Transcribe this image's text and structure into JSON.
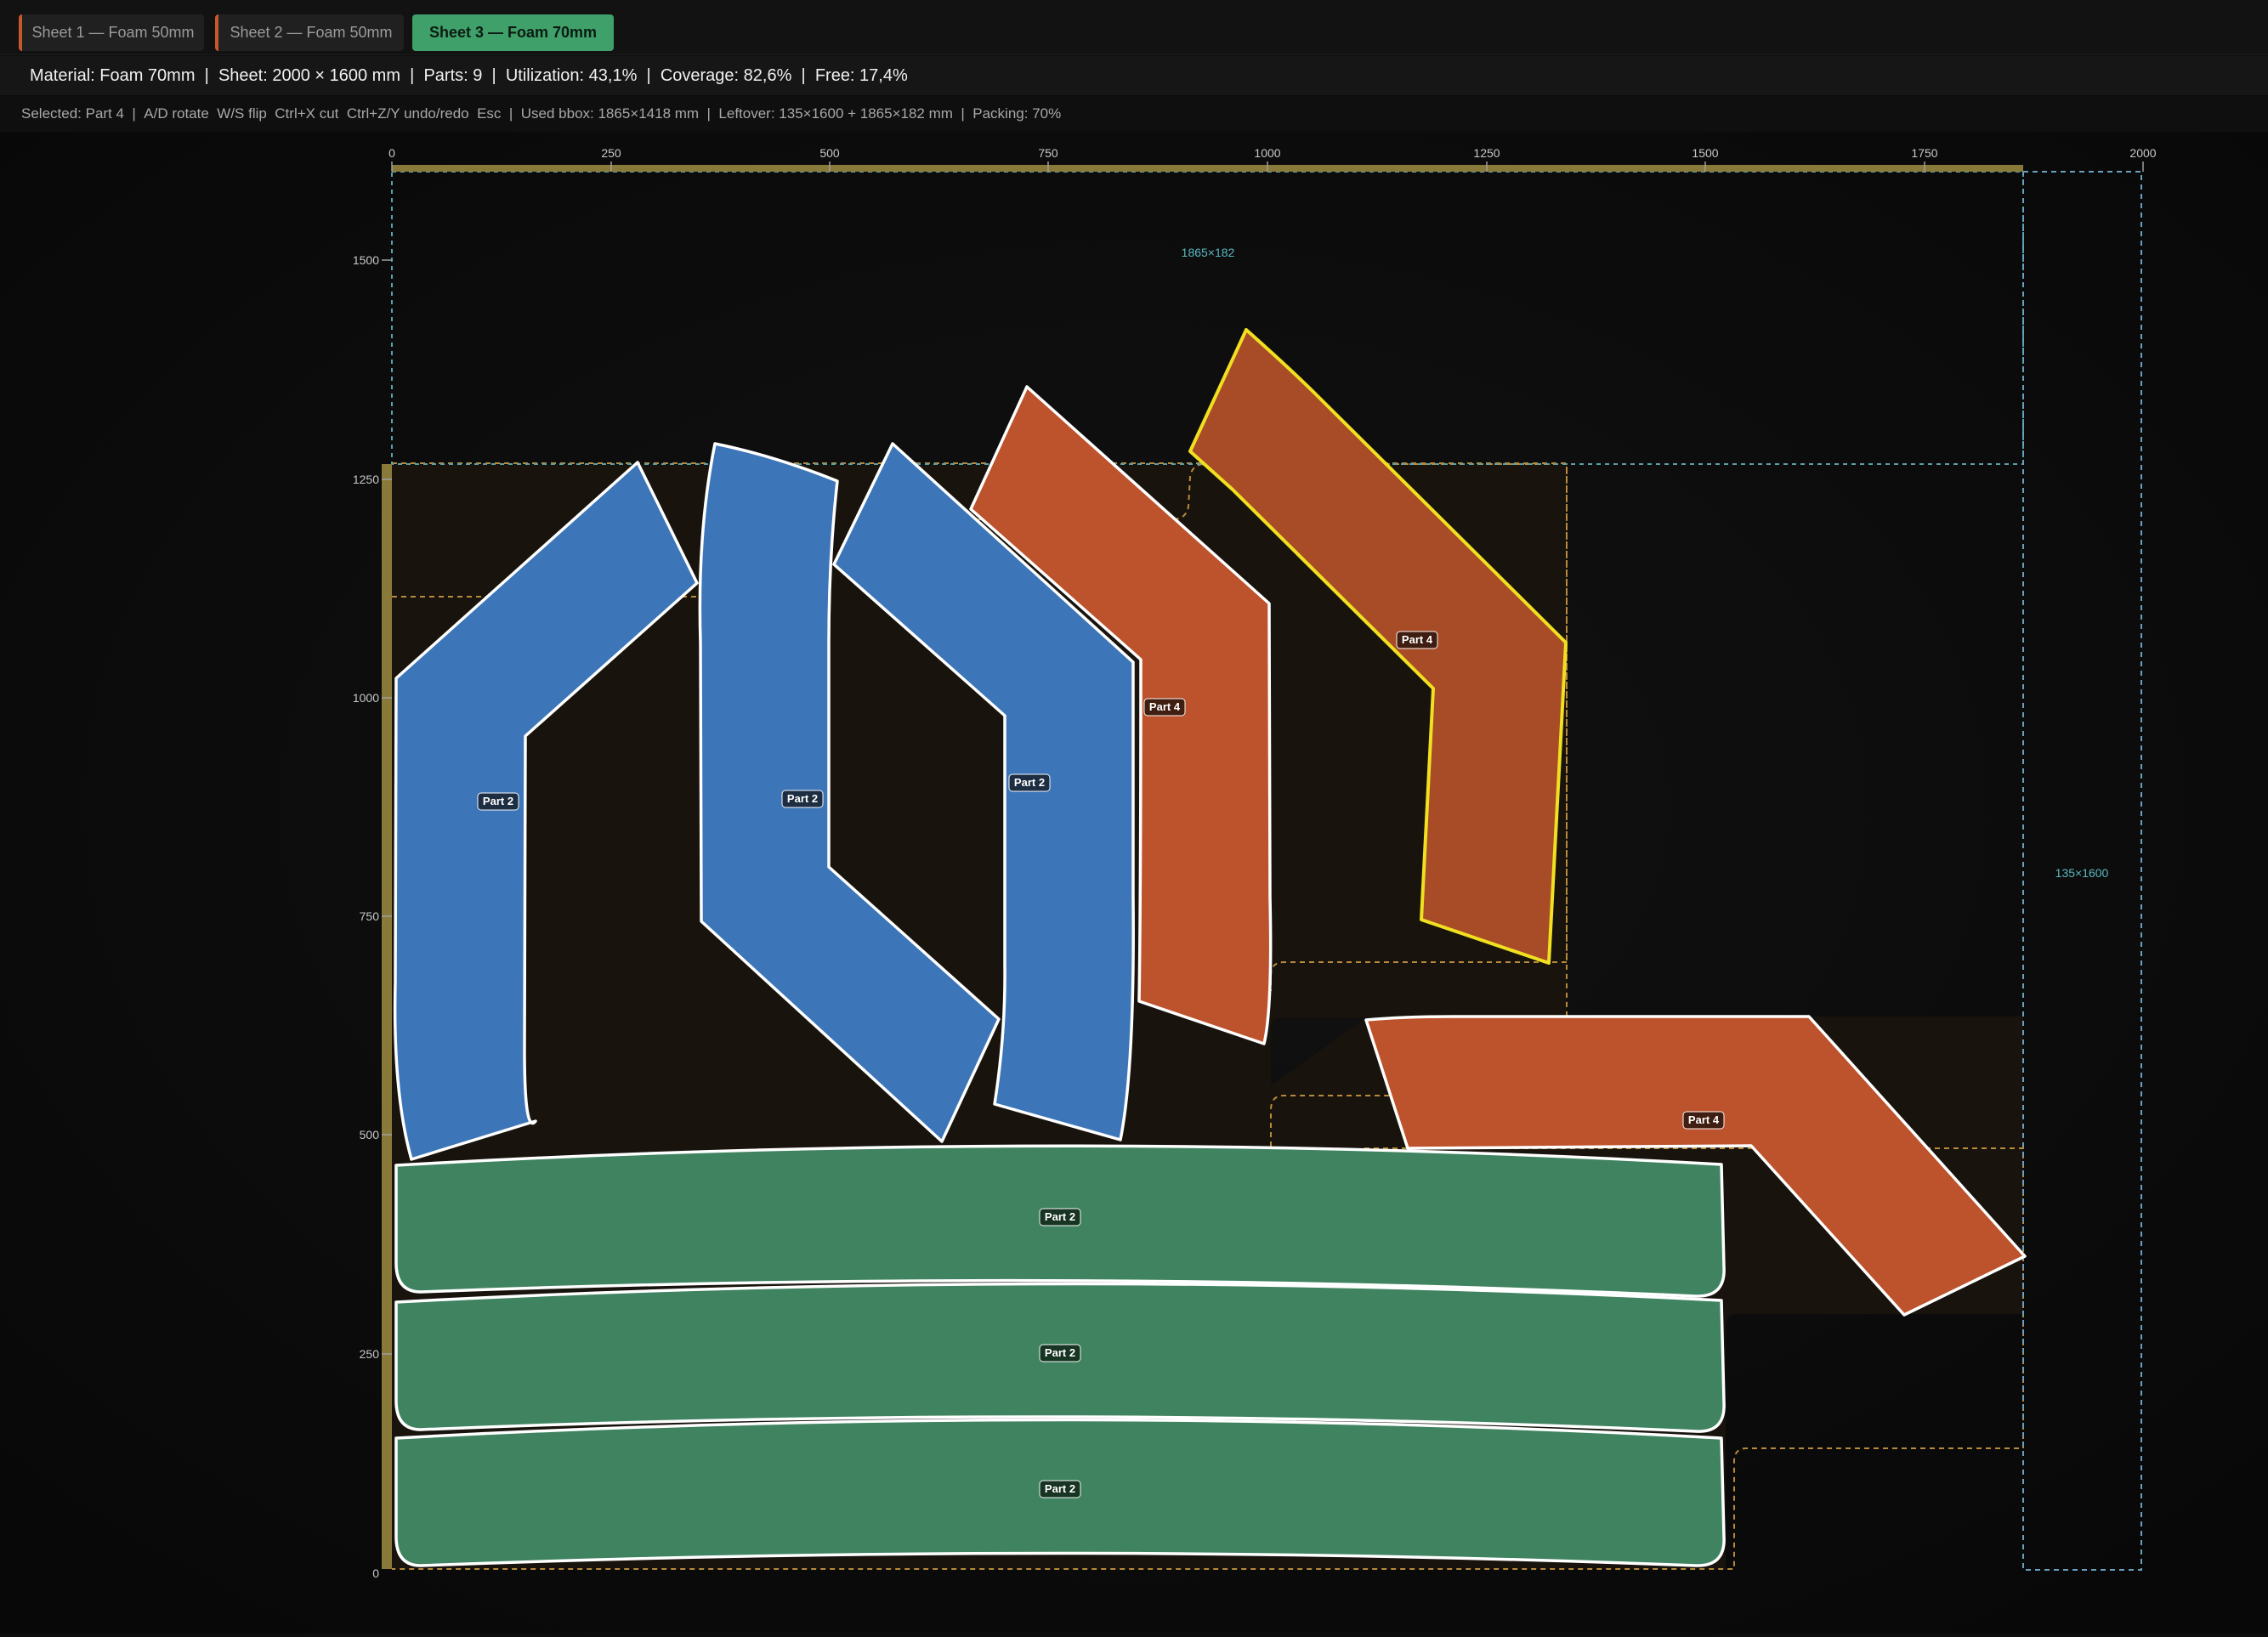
{
  "tabs": [
    {
      "label": "Sheet 1 — Foam 50mm",
      "active": false
    },
    {
      "label": "Sheet 2 — Foam 50mm",
      "active": false
    },
    {
      "label": "Sheet 3 — Foam 70mm",
      "active": true
    }
  ],
  "info": {
    "material": "Material: Foam 70mm",
    "sheet": "Sheet: 2000 × 1600 mm",
    "parts": "Parts: 9",
    "utilization": "Utilization: 43,1%",
    "coverage": "Coverage: 82,6%",
    "free": "Free: 17,4%",
    "separator": "|"
  },
  "hints": {
    "selected": "Selected: Part 4",
    "keys": "A/D rotate  W/S flip  Ctrl+X cut  Ctrl+Z/Y undo/redo  Esc",
    "used_bbox": "Used bbox: 1865×1418 mm",
    "leftover": "Leftover: 135×1600 + 1865×182 mm",
    "packing": "Packing: 70%",
    "separator": "|"
  },
  "axes": {
    "x_ticks": [
      "0",
      "250",
      "500",
      "750",
      "1000",
      "1250",
      "1500",
      "1750",
      "2000"
    ],
    "y_ticks": [
      "1500",
      "1250",
      "1000",
      "750",
      "500",
      "250",
      "0"
    ]
  },
  "leftover_labels": {
    "top": "1865×182",
    "right": "135×1600"
  },
  "parts": [
    {
      "label": "Part 2",
      "color": "#3d76b8",
      "selected": false
    },
    {
      "label": "Part 2",
      "color": "#3d76b8",
      "selected": false
    },
    {
      "label": "Part 2",
      "color": "#3d76b8",
      "selected": false
    },
    {
      "label": "Part 4",
      "color": "#bd532c",
      "selected": false
    },
    {
      "label": "Part 4",
      "color": "#a84c28",
      "selected": true
    },
    {
      "label": "Part 4",
      "color": "#bd532c",
      "selected": false
    },
    {
      "label": "Part 2",
      "color": "#3f8360",
      "selected": false
    },
    {
      "label": "Part 2",
      "color": "#3f8360",
      "selected": false
    },
    {
      "label": "Part 2",
      "color": "#3f8360",
      "selected": false
    }
  ],
  "colors": {
    "sheet_edge": "#8a7a3a",
    "selected_outline": "#f0e020",
    "leftover_line": "#5aa0a8",
    "envelope_line": "#b88a3a"
  }
}
